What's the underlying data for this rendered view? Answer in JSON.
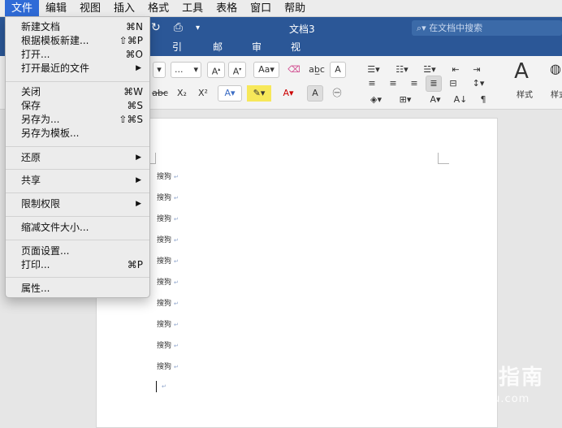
{
  "menubar": {
    "items": [
      "文件",
      "编辑",
      "视图",
      "插入",
      "格式",
      "工具",
      "表格",
      "窗口",
      "帮助"
    ]
  },
  "window": {
    "doc_title": "文档3",
    "search_placeholder": "在文档中搜索",
    "tabs": [
      "引用",
      "邮件",
      "审阅",
      "视图"
    ]
  },
  "ribbon": {
    "font_size_value": "...",
    "styles_label": "样式",
    "styles_pane_label": "样式窗格"
  },
  "file_menu": {
    "items": [
      {
        "label": "新建文档",
        "shortcut": "⌘N"
      },
      {
        "label": "根据模板新建...",
        "shortcut": "⇧⌘P"
      },
      {
        "label": "打开...",
        "shortcut": "⌘O"
      },
      {
        "label": "打开最近的文件",
        "shortcut": "▶"
      },
      {
        "label": "关闭",
        "shortcut": "⌘W"
      },
      {
        "label": "保存",
        "shortcut": "⌘S"
      },
      {
        "label": "另存为...",
        "shortcut": "⇧⌘S"
      },
      {
        "label": "另存为模板...",
        "shortcut": ""
      },
      {
        "label": "还原",
        "shortcut": "▶"
      },
      {
        "label": "共享",
        "shortcut": "▶"
      },
      {
        "label": "限制权限",
        "shortcut": "▶"
      },
      {
        "label": "缩减文件大小...",
        "shortcut": ""
      },
      {
        "label": "页面设置...",
        "shortcut": ""
      },
      {
        "label": "打印...",
        "shortcut": "⌘P"
      },
      {
        "label": "属性...",
        "shortcut": ""
      }
    ]
  },
  "document": {
    "lines": [
      "搜狗",
      "搜狗",
      "搜狗",
      "搜狗",
      "搜狗",
      "搜狗",
      "搜狗",
      "搜狗",
      "搜狗",
      "搜狗"
    ]
  },
  "watermark": {
    "name": "搜狗指南",
    "url": "zhinan.sogou.com"
  },
  "colors": {
    "title_bar": "#2b5797",
    "menu_highlight": "#2f6bd7"
  }
}
